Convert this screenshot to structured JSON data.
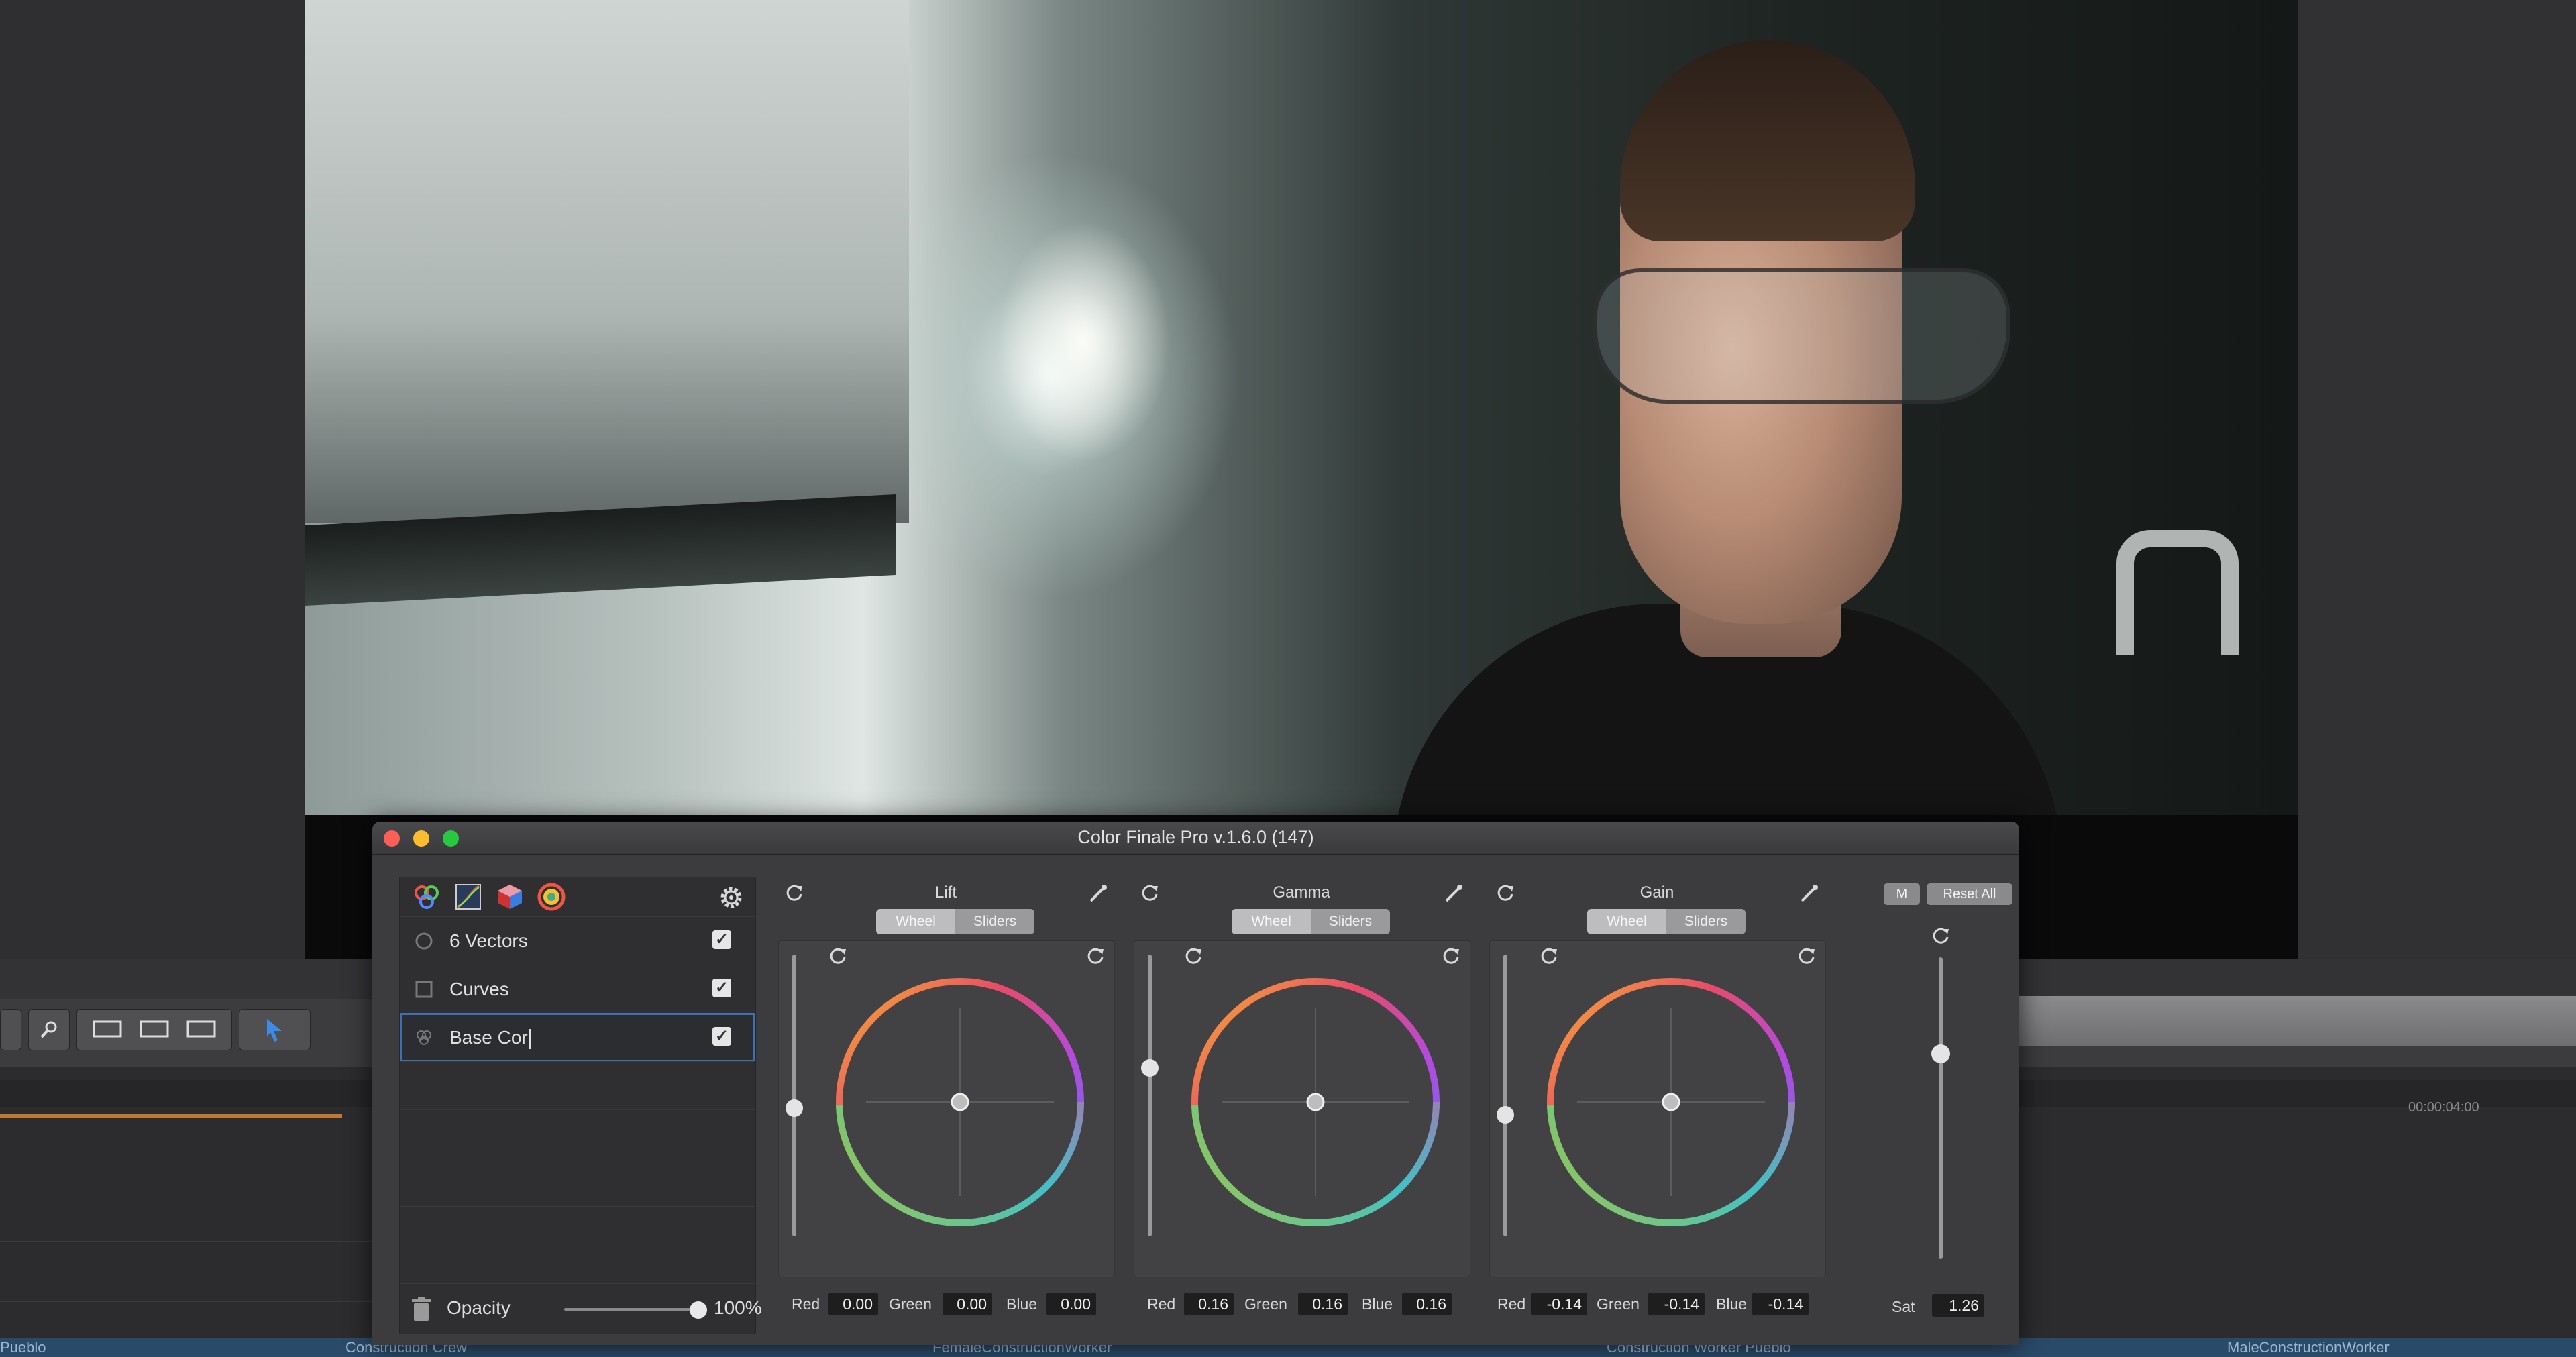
{
  "window": {
    "title": "Color Finale Pro v.1.6.0 (147)"
  },
  "layers_panel": {
    "icons": [
      "color-wheels-icon",
      "curves-icon",
      "cube-icon",
      "vectors-icon"
    ],
    "settings_icon": "gear-icon",
    "layers": [
      {
        "name": "6 Vectors",
        "icon": "vectors-icon",
        "enabled": true,
        "selected": false
      },
      {
        "name": "Curves",
        "icon": "curves-icon",
        "enabled": true,
        "selected": false
      },
      {
        "name": "Base Cor",
        "icon": "color-wheels-icon",
        "enabled": true,
        "selected": true,
        "editing": true
      }
    ],
    "opacity": {
      "label": "Opacity",
      "value": "100%",
      "fraction": 1.0
    }
  },
  "wheels": [
    {
      "title": "Lift",
      "mode_tabs": [
        "Wheel",
        "Sliders"
      ],
      "active_tab": "Wheel",
      "slider_level": 0.45,
      "values": [
        {
          "label": "Red",
          "value": "0.00"
        },
        {
          "label": "Green",
          "value": "0.00"
        },
        {
          "label": "Blue",
          "value": "0.00"
        }
      ]
    },
    {
      "title": "Gamma",
      "mode_tabs": [
        "Wheel",
        "Sliders"
      ],
      "active_tab": "Wheel",
      "slider_level": 0.58,
      "values": [
        {
          "label": "Red",
          "value": "0.16"
        },
        {
          "label": "Green",
          "value": "0.16"
        },
        {
          "label": "Blue",
          "value": "0.16"
        }
      ]
    },
    {
      "title": "Gain",
      "mode_tabs": [
        "Wheel",
        "Sliders"
      ],
      "active_tab": "Wheel",
      "slider_level": 0.42,
      "values": [
        {
          "label": "Red",
          "value": "-0.14"
        },
        {
          "label": "Green",
          "value": "-0.14"
        },
        {
          "label": "Blue",
          "value": "-0.14"
        }
      ]
    }
  ],
  "saturation": {
    "label": "Sat",
    "value": "1.26",
    "slider_level": 0.62
  },
  "top_buttons": {
    "m": "M",
    "reset_all": "Reset All"
  },
  "host_editor": {
    "timecode": "00:00:04:00",
    "clip_labels": [
      "Pueblo",
      "Construction Crew",
      "FemaleConstructionWorker",
      "Construction Worker Pueblo",
      "MaleConstructionWorker"
    ]
  },
  "colors": {
    "accent": "#3f6fb5",
    "close": "#fc5f57",
    "minimize": "#fdbc2e",
    "zoom": "#28c840"
  }
}
